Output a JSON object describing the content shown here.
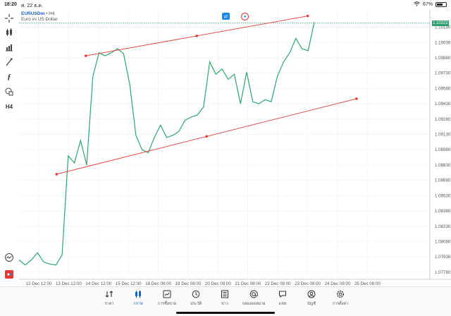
{
  "status": {
    "time": "18:20",
    "date": "ศ. 22 ธ.ค.",
    "battery": "67%",
    "battery_level": 0.67
  },
  "symbol": {
    "name": "EURUSDm",
    "timeframe": "• H4",
    "description": "Euro vs US Dollar"
  },
  "left_toolbar": [
    {
      "icon": "crosshair-icon"
    },
    {
      "icon": "indicator-icon"
    },
    {
      "icon": "bar-chart-icon"
    },
    {
      "icon": "line-tool-icon"
    },
    {
      "icon": "function-icon"
    },
    {
      "icon": "shapes-icon"
    },
    {
      "icon": "timeframe-icon",
      "text": "H4"
    }
  ],
  "chart_data": {
    "type": "line",
    "title": "EURUSDm",
    "x": [
      "12 Dec 12:00",
      "",
      "",
      "",
      "",
      "",
      "13 Dec 12:00",
      "",
      "",
      "",
      "",
      "",
      "14 Dec 12:00",
      "",
      "",
      "",
      "",
      "",
      "15 Dec 12:00",
      "",
      "",
      "",
      "",
      "",
      "18 Dec 08:00",
      "",
      "",
      "",
      "",
      "",
      "19 Dec 08:00",
      "",
      "",
      "",
      "",
      "",
      "20 Dec 08:00",
      "",
      "",
      "",
      "",
      "",
      "21 Dec 08:00",
      "",
      "",
      "",
      "",
      "",
      "22 Dec 08:00"
    ],
    "y": [
      1.079,
      1.0785,
      1.079,
      1.0797,
      1.0788,
      1.0786,
      1.0785,
      1.0795,
      1.0892,
      1.0885,
      1.0907,
      1.0883,
      1.097,
      1.0993,
      1.099,
      1.0993,
      1.0997,
      1.0992,
      1.0962,
      1.0912,
      1.0898,
      1.0895,
      1.091,
      1.0922,
      1.091,
      1.0912,
      1.0916,
      1.0927,
      1.093,
      1.0932,
      1.094,
      1.0984,
      1.0972,
      1.0977,
      1.0967,
      1.0972,
      1.0943,
      1.0974,
      1.0945,
      1.0943,
      1.0947,
      1.0945,
      1.097,
      1.0984,
      1.0993,
      1.1007,
      1.0997,
      1.0995,
      1.1023
    ],
    "x_ticks": [
      "12 Dec 12:00",
      "13 Dec 12:00",
      "14 Dec 12:00",
      "15 Dec 12:00",
      "18 Dec 08:00",
      "19 Dec 08:00",
      "20 Dec 08:00",
      "21 Dec 08:00",
      "22 Dec 08:00",
      "23 Dec 08:00",
      "24 Dec 08:00",
      "25 Dec 08:00"
    ],
    "y_ticks": [
      "1.10180",
      "1.10030",
      "1.09880",
      "1.09730",
      "1.09580",
      "1.09430",
      "1.09280",
      "1.09130",
      "1.08980",
      "1.08830",
      "1.08680",
      "1.08530",
      "1.08380",
      "1.08230",
      "1.08080",
      "1.07930",
      "1.07780"
    ],
    "ylim": [
      1.0771,
      1.1035
    ],
    "current_price": "1.10222",
    "current_price_value": 1.10222,
    "trendlines": [
      {
        "from": [
          "14 Dec 12:00",
          1.099
        ],
        "to": [
          "23 Dec 08:00",
          1.1029
        ]
      },
      {
        "from": [
          "13 Dec 12:00",
          1.0874
        ],
        "to": [
          "24 Dec 08:00",
          1.0948
        ]
      }
    ],
    "colors": {
      "line": "#2ea66f",
      "trendline": "#e53935",
      "grid": "#ececec"
    }
  },
  "tabs": [
    {
      "label": "ราคา",
      "icon": "quotes-icon",
      "active": false
    },
    {
      "label": "กราฟ",
      "icon": "chart-icon",
      "active": true
    },
    {
      "label": "การซื้อขาย",
      "icon": "trade-icon",
      "active": false
    },
    {
      "label": "ประวัติ",
      "icon": "history-icon",
      "active": false
    },
    {
      "label": "ข่าว",
      "icon": "news-icon",
      "active": false
    },
    {
      "label": "กล่องจดหมาย",
      "icon": "mailbox-icon",
      "active": false
    },
    {
      "label": "แชท",
      "icon": "chat-icon",
      "active": false
    },
    {
      "label": "บัญชี",
      "icon": "account-icon",
      "active": false
    },
    {
      "label": "การตั้งค่า",
      "icon": "settings-icon",
      "active": false
    }
  ]
}
